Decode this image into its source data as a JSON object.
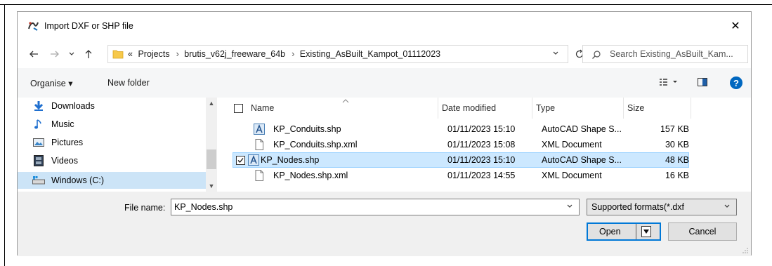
{
  "window": {
    "title": "Import DXF or SHP file",
    "close_glyph": "✕"
  },
  "address": {
    "crumbs": [
      "«",
      "Projects",
      "brutis_v62j_freeware_64b",
      "Existing_AsBuilt_Kampot_01112023"
    ],
    "separator": "›",
    "search_placeholder": "Search Existing_AsBuilt_Kam..."
  },
  "toolbar": {
    "organise_label": "Organise ▾",
    "new_folder_label": "New folder"
  },
  "nav": {
    "items": [
      {
        "label": "Downloads",
        "icon": "download-arrow-icon"
      },
      {
        "label": "Music",
        "icon": "music-note-icon"
      },
      {
        "label": "Pictures",
        "icon": "pictures-icon"
      },
      {
        "label": "Videos",
        "icon": "videos-icon"
      },
      {
        "label": "Windows  (C:)",
        "icon": "drive-icon"
      }
    ]
  },
  "files": {
    "columns": {
      "name": "Name",
      "date": "Date modified",
      "type": "Type",
      "size": "Size"
    },
    "rows": [
      {
        "name": "KP_Conduits.shp",
        "date": "01/11/2023 15:10",
        "type": "AutoCAD Shape S...",
        "size": "157 KB",
        "icon": "autocad-shape-icon",
        "selected": false
      },
      {
        "name": "KP_Conduits.shp.xml",
        "date": "01/11/2023 15:08",
        "type": "XML Document",
        "size": "30 KB",
        "icon": "document-icon",
        "selected": false
      },
      {
        "name": "KP_Nodes.shp",
        "date": "01/11/2023 15:10",
        "type": "AutoCAD Shape S...",
        "size": "48 KB",
        "icon": "autocad-shape-icon",
        "selected": true
      },
      {
        "name": "KP_Nodes.shp.xml",
        "date": "01/11/2023 14:55",
        "type": "XML Document",
        "size": "16 KB",
        "icon": "document-icon",
        "selected": false
      }
    ]
  },
  "bottom": {
    "file_name_label": "File name:",
    "file_name_value": "KP_Nodes.shp",
    "filter_value": "Supported formats(*.dxf",
    "open_label": "Open",
    "cancel_label": "Cancel"
  },
  "colors": {
    "accent": "#0078d7",
    "selection": "#cce8ff",
    "folder": "#f7c94a"
  }
}
